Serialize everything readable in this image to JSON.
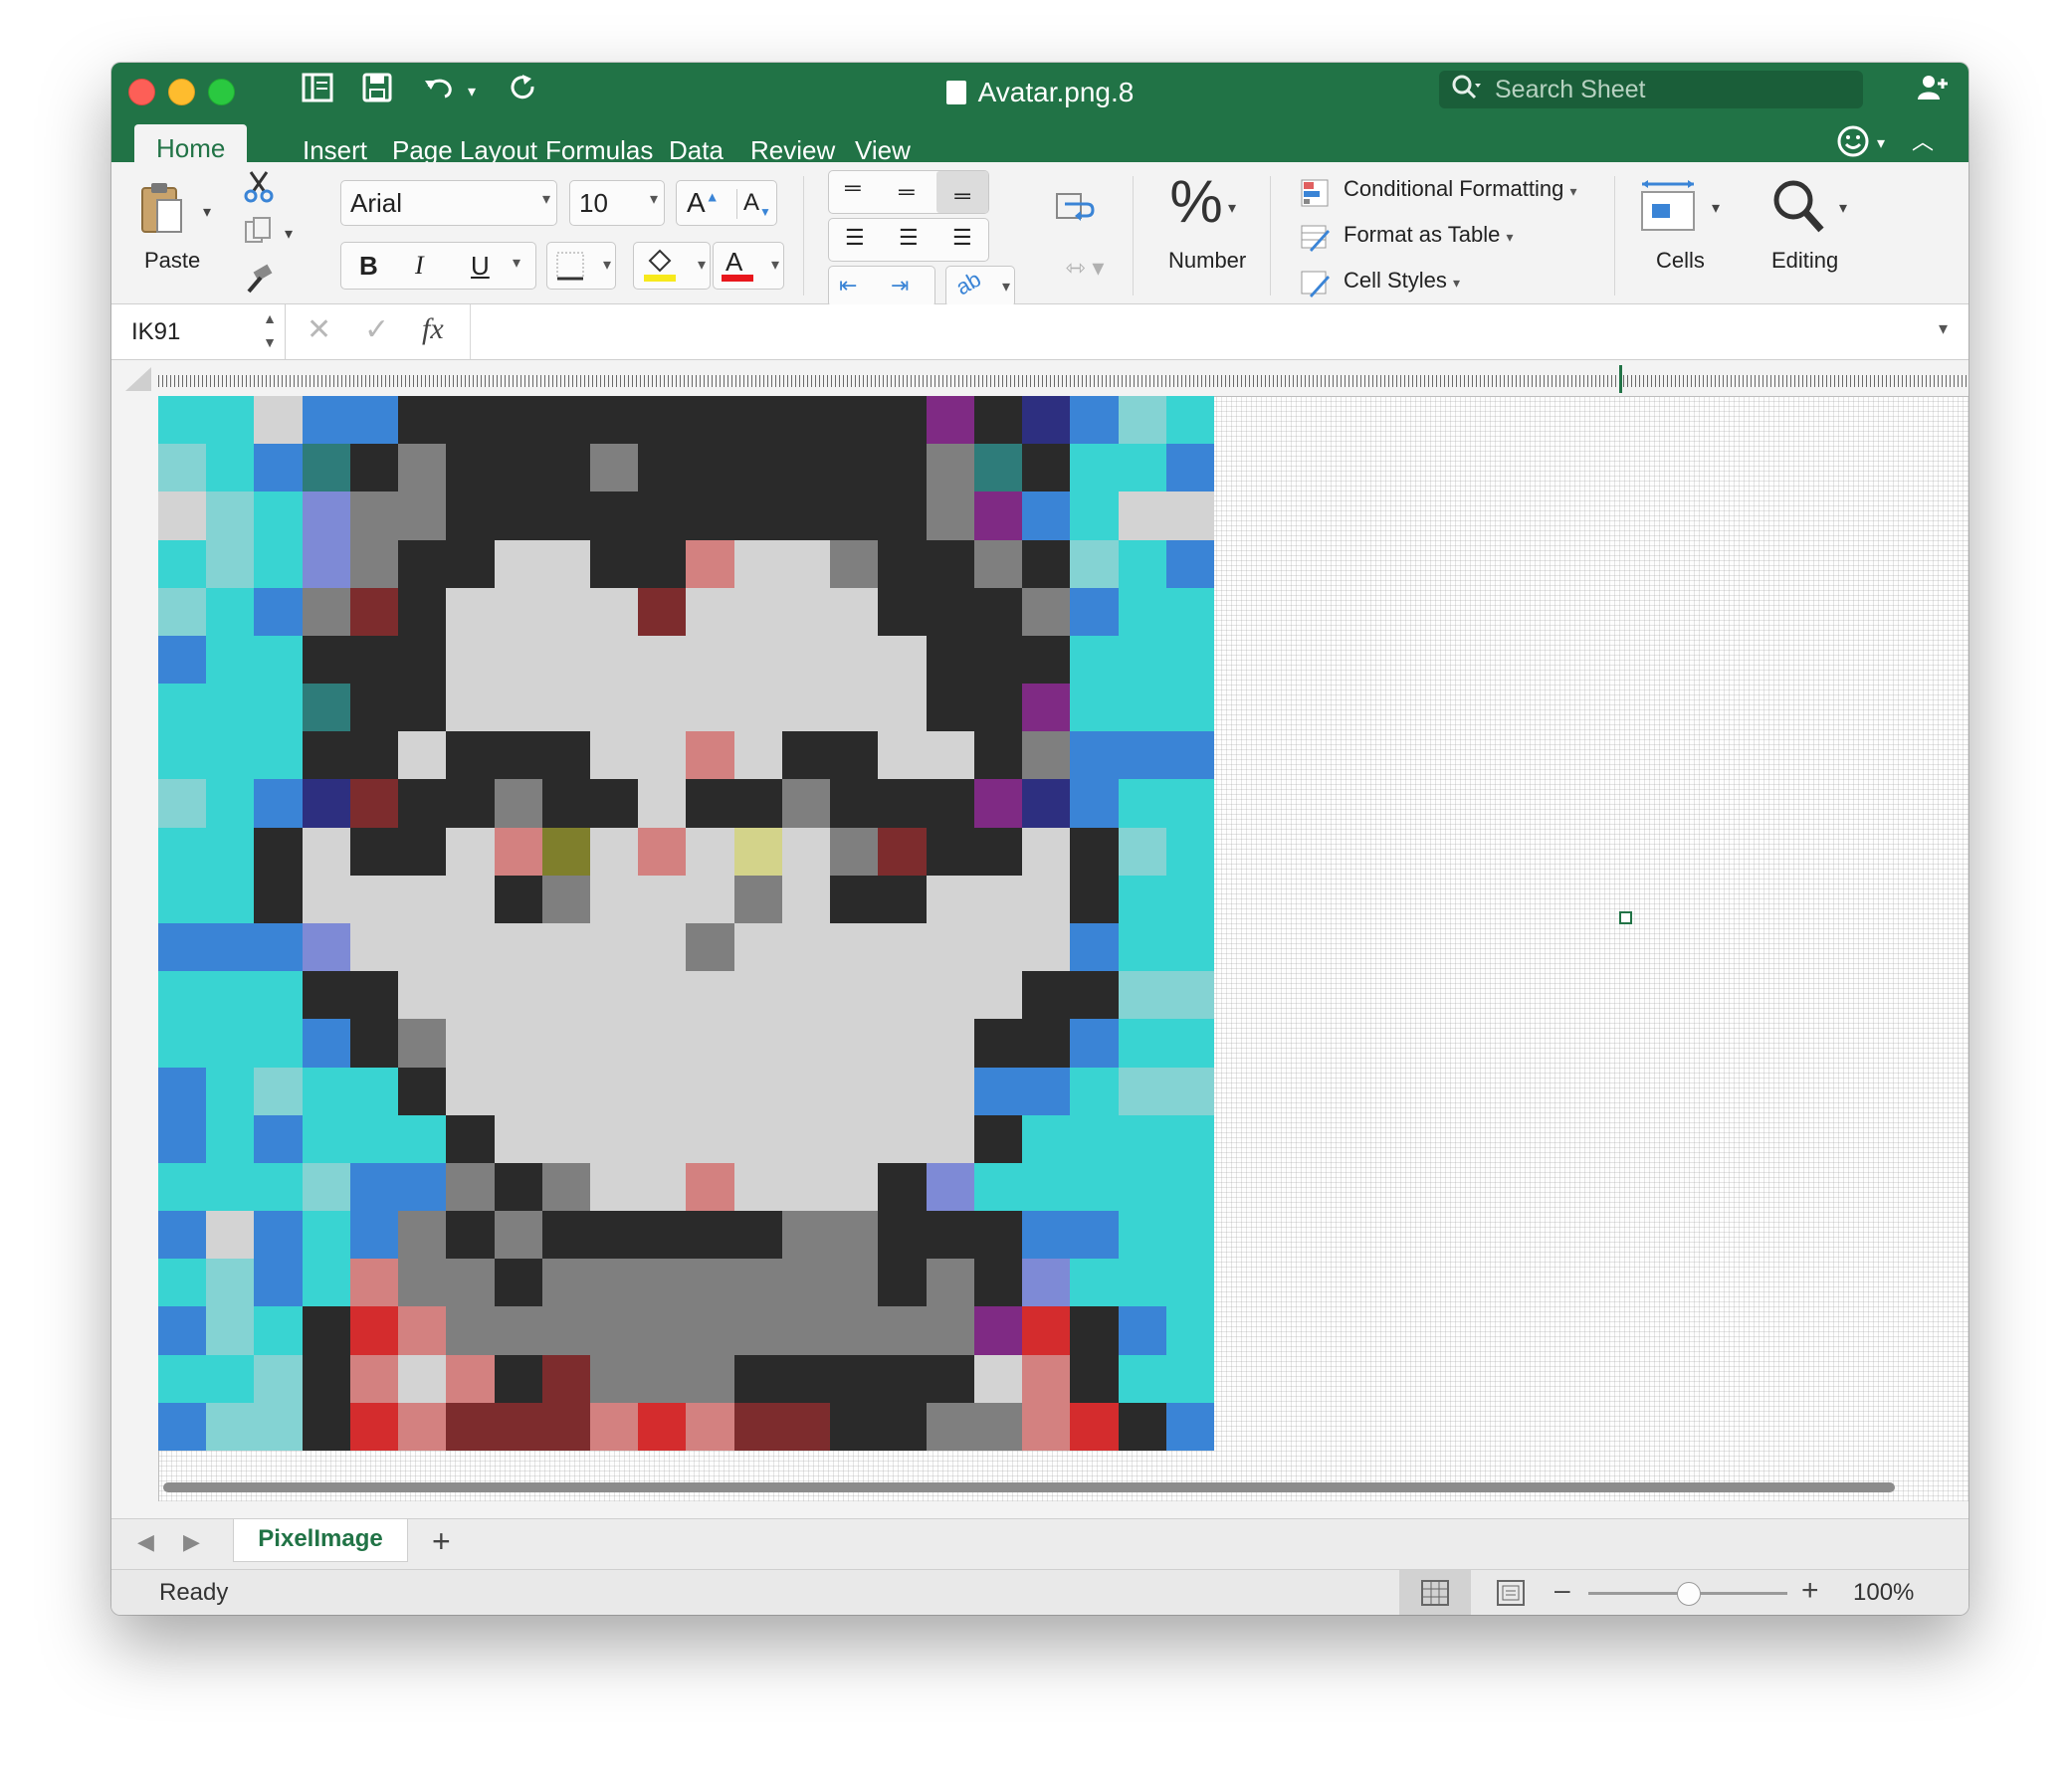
{
  "window": {
    "title": "Avatar.png.8"
  },
  "search": {
    "placeholder": "Search Sheet"
  },
  "tabs": [
    "Home",
    "Insert",
    "Page Layout",
    "Formulas",
    "Data",
    "Review",
    "View"
  ],
  "ribbon": {
    "paste": "Paste",
    "font_name": "Arial",
    "font_size": "10",
    "bold": "B",
    "italic": "I",
    "underline": "U",
    "number": "Number",
    "percent": "%",
    "conditional_formatting": "Conditional Formatting",
    "format_as_table": "Format as Table",
    "cell_styles": "Cell Styles",
    "cells": "Cells",
    "editing": "Editing"
  },
  "formula_bar": {
    "name_box": "IK91",
    "fx": "fx",
    "formula": ""
  },
  "sheet": {
    "tab_label": "PixelImage"
  },
  "status": {
    "ready": "Ready",
    "zoom": "100%"
  },
  "palette": {
    "A": "#39d4d2",
    "B": "#3a84d6",
    "C": "#d3d3d3",
    "D": "#2a2a2a",
    "E": "#7f7f7f",
    "F": "#84d3d3",
    "G": "#2e7c7a",
    "H": "#7e8ad6",
    "I": "#7d2c2d",
    "J": "#7f2a84",
    "K": "#2d2f80",
    "L": "#d38180",
    "M": "#7f7f2c",
    "N": "#d3d38a",
    "O": "#d42c2d"
  },
  "pixel_image": [
    "AACBBDDDDDDDDDDDJDKBFA",
    "FABGDEDDDEDDDDDDEGDAAB",
    "CFAHEEDDDDDDDDDDEJBACC",
    "AFAHEDDCCDDLCCEDDEDFAB",
    "FABEIDCCCCICCCCDDDEBAA",
    "BAADDDCCCCCCCCCCDDDAAA",
    "AAAGDDCCCCCCCCCCDDJAAA",
    "AAADDCDDDCCLCDDCCDEBBB",
    "FABKIDDEDDCDDEDDDJKBAA",
    "AADCDDCLMCLCNCEIDDCDFA",
    "AADCCCCDECCCECDDCCCDAA",
    "BBBHCCCCCCCECCCCCCCBAA",
    "AAADDCCCCCCCCCCCCCDDFF",
    "AAABDECCCCCCCCCCCDDBAA",
    "BAFAADCCCCCCCCCCCBBAFF",
    "BABAAADCCCCCCCCCCDAAAA",
    "AAAFBBEDECCLCCCDHAAAAA",
    "BCBABEDEDDDDDEEDDDBBAA",
    "AFBALEEDEEEEEEEDEDHAAA",
    "BFADOLEEEEEEEEEEEJODBA",
    "AAFDLCLDIEEEDDDDDCLDAA",
    "BFFDOLIIILOLIIDDEELODB"
  ]
}
